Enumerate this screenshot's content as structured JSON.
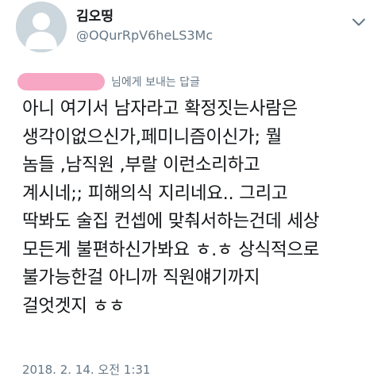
{
  "author": {
    "display_name": "김오띵",
    "handle": "@OQurRpV6heLS3Mc",
    "avatar_icon": "default-avatar-icon"
  },
  "menu_icon": "chevron-down-icon",
  "reply": {
    "mention_tail": "님에게 보내는 답글",
    "redaction_color": "#f7a6c3"
  },
  "tweet": {
    "text": "아니 여기서 남자라고 확정짓는사람은\n생각이없으신가,페미니즘이신가; 뭘\n놈들 ,남직원 ,부랄 이런소리하고\n계시네;; 피해의식 지리네요.. 그리고\n딱봐도 술집 컨셉에 맞춰서하는건데 세상\n모든게 불편하신가봐요 ㅎ.ㅎ 상식적으로\n불가능한걸 아니까 직원얘기까지\n걸엇겟지 ㅎㅎ",
    "timestamp": "2018. 2. 14. 오전 1:31"
  },
  "colors": {
    "text": "#14171a",
    "secondary": "#657786",
    "avatar_bg": "#ccd6dd",
    "avatar_fg": "#ffffff"
  }
}
